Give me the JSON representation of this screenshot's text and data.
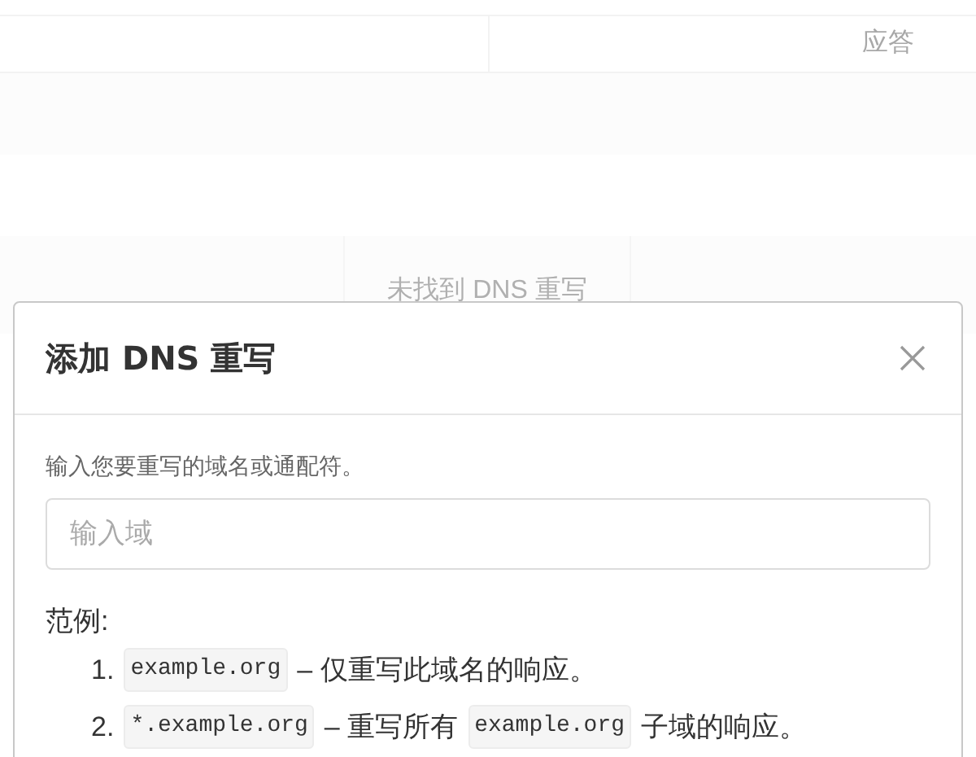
{
  "table": {
    "columns": [
      "",
      "应答"
    ],
    "empty_text": "未找到 DNS 重写"
  },
  "dialog": {
    "title": "添加 DNS 重写",
    "hint": "输入您要重写的域名或通配符。",
    "domain_field": {
      "placeholder": "输入域"
    },
    "examples_label": "范例:",
    "examples": [
      {
        "number": "1.",
        "parts": [
          {
            "kind": "code",
            "text": "example.org"
          },
          {
            "kind": "text",
            "text": "– 仅重写此域名的响应。"
          }
        ]
      },
      {
        "number": "2.",
        "parts": [
          {
            "kind": "code",
            "text": "*.example.org"
          },
          {
            "kind": "text",
            "text": "– 重写所有"
          },
          {
            "kind": "code",
            "text": "example.org"
          },
          {
            "kind": "text",
            "text": "子域的响应。"
          }
        ]
      }
    ]
  }
}
